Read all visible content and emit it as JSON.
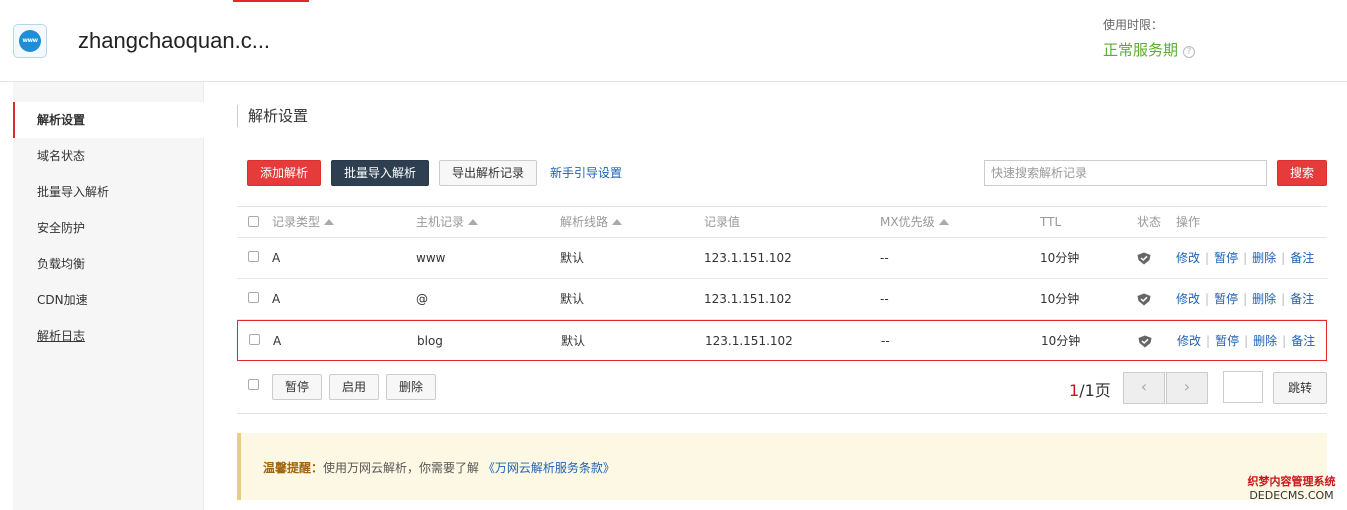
{
  "header": {
    "domain_title": "zhangchaoquan.c...",
    "logo_text": "www",
    "service_label": "使用时限：",
    "service_status": "正常服务期",
    "help_glyph": "?",
    "accent_color": "#e0282e",
    "status_color": "#5aae2e"
  },
  "sidebar": {
    "items": [
      {
        "label": "解析设置"
      },
      {
        "label": "域名状态"
      },
      {
        "label": "批量导入解析"
      },
      {
        "label": "安全防护"
      },
      {
        "label": "负载均衡"
      },
      {
        "label": "CDN加速"
      },
      {
        "label": "解析日志"
      }
    ]
  },
  "main": {
    "section_title": "解析设置",
    "toolbar": {
      "add_label": "添加解析",
      "import_label": "批量导入解析",
      "export_label": "导出解析记录",
      "guide_label": "新手引导设置",
      "search_placeholder": "快速搜索解析记录",
      "search_label": "搜索"
    },
    "table": {
      "headers": {
        "type": "记录类型",
        "host": "主机记录",
        "line": "解析线路",
        "value": "记录值",
        "mx": "MX优先级",
        "ttl": "TTL",
        "status": "状态",
        "ops": "操作"
      },
      "rows": [
        {
          "type": "A",
          "host": "www",
          "line": "默认",
          "value": "123.1.151.102",
          "mx": "--",
          "ttl": "10分钟",
          "status_icon": "shield-icon"
        },
        {
          "type": "A",
          "host": "@",
          "line": "默认",
          "value": "123.1.151.102",
          "mx": "--",
          "ttl": "10分钟",
          "status_icon": "shield-icon"
        },
        {
          "type": "A",
          "host": "blog",
          "line": "默认",
          "value": "123.1.151.102",
          "mx": "--",
          "ttl": "10分钟",
          "status_icon": "shield-icon"
        }
      ],
      "ops": {
        "edit": "修改",
        "pause": "暂停",
        "delete": "删除",
        "note": "备注"
      },
      "highlight_row": 2
    },
    "bulk": {
      "pause_label": "暂停",
      "enable_label": "启用",
      "delete_label": "删除"
    },
    "pager": {
      "current": "1",
      "total_text": "/1页",
      "prev_glyph": "‹",
      "next_glyph": "›",
      "jump_label": "跳转"
    },
    "notice": {
      "strong": "温馨提醒：",
      "text": "使用万网云解析，你需要了解",
      "link": "《万网云解析服务条款》"
    }
  },
  "watermark": {
    "line1": "织梦内容管理系统",
    "line2": "DEDECMS.COM"
  }
}
